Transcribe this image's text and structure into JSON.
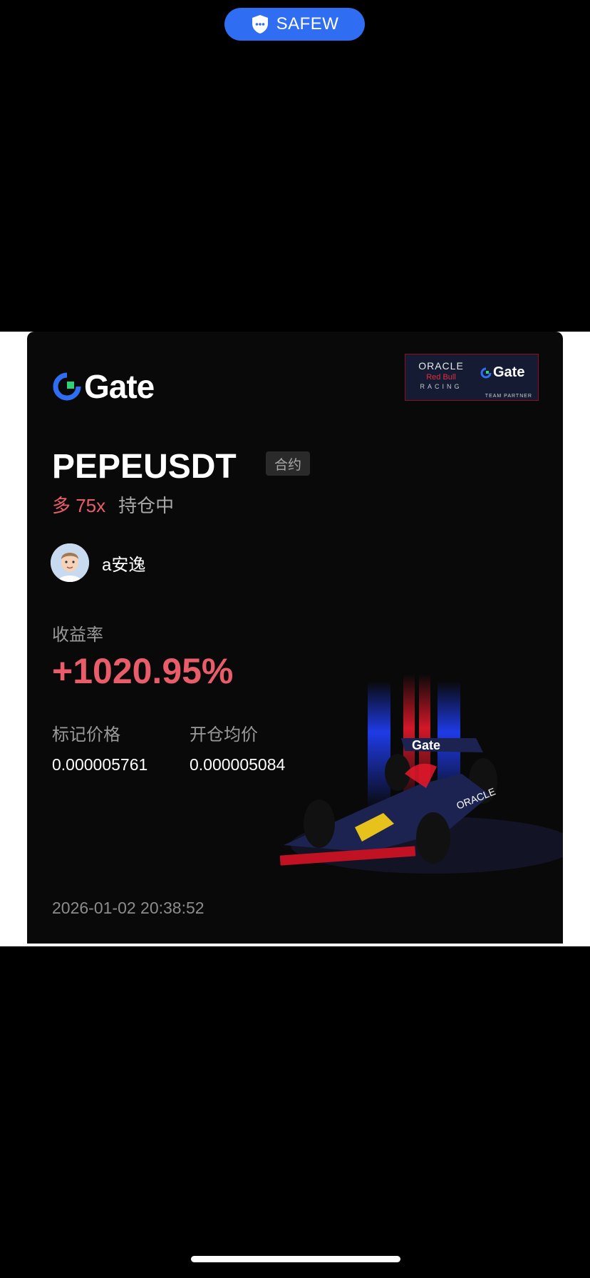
{
  "top_badge": {
    "label": "SAFEW"
  },
  "card": {
    "brand": "Gate",
    "partner": {
      "oracle": "ORACLE",
      "red_bull": "Red Bull",
      "racing": "RACING",
      "brand": "Gate",
      "team_partner": "TEAM PARTNER"
    },
    "symbol": "PEPEUSDT",
    "contract_tag": "合约",
    "direction": "多 75x",
    "status": "持仓中",
    "username": "a安逸",
    "yield_label": "收益率",
    "yield_value": "+1020.95%",
    "mark_price_label": "标记价格",
    "mark_price_value": "0.000005761",
    "entry_price_label": "开仓均价",
    "entry_price_value": "0.000005084",
    "timestamp": "2026-01-02 20:38:52"
  },
  "colors": {
    "pill_blue": "#2f6ef3",
    "profit_red": "#e85d69",
    "card_bg": "#090909"
  }
}
